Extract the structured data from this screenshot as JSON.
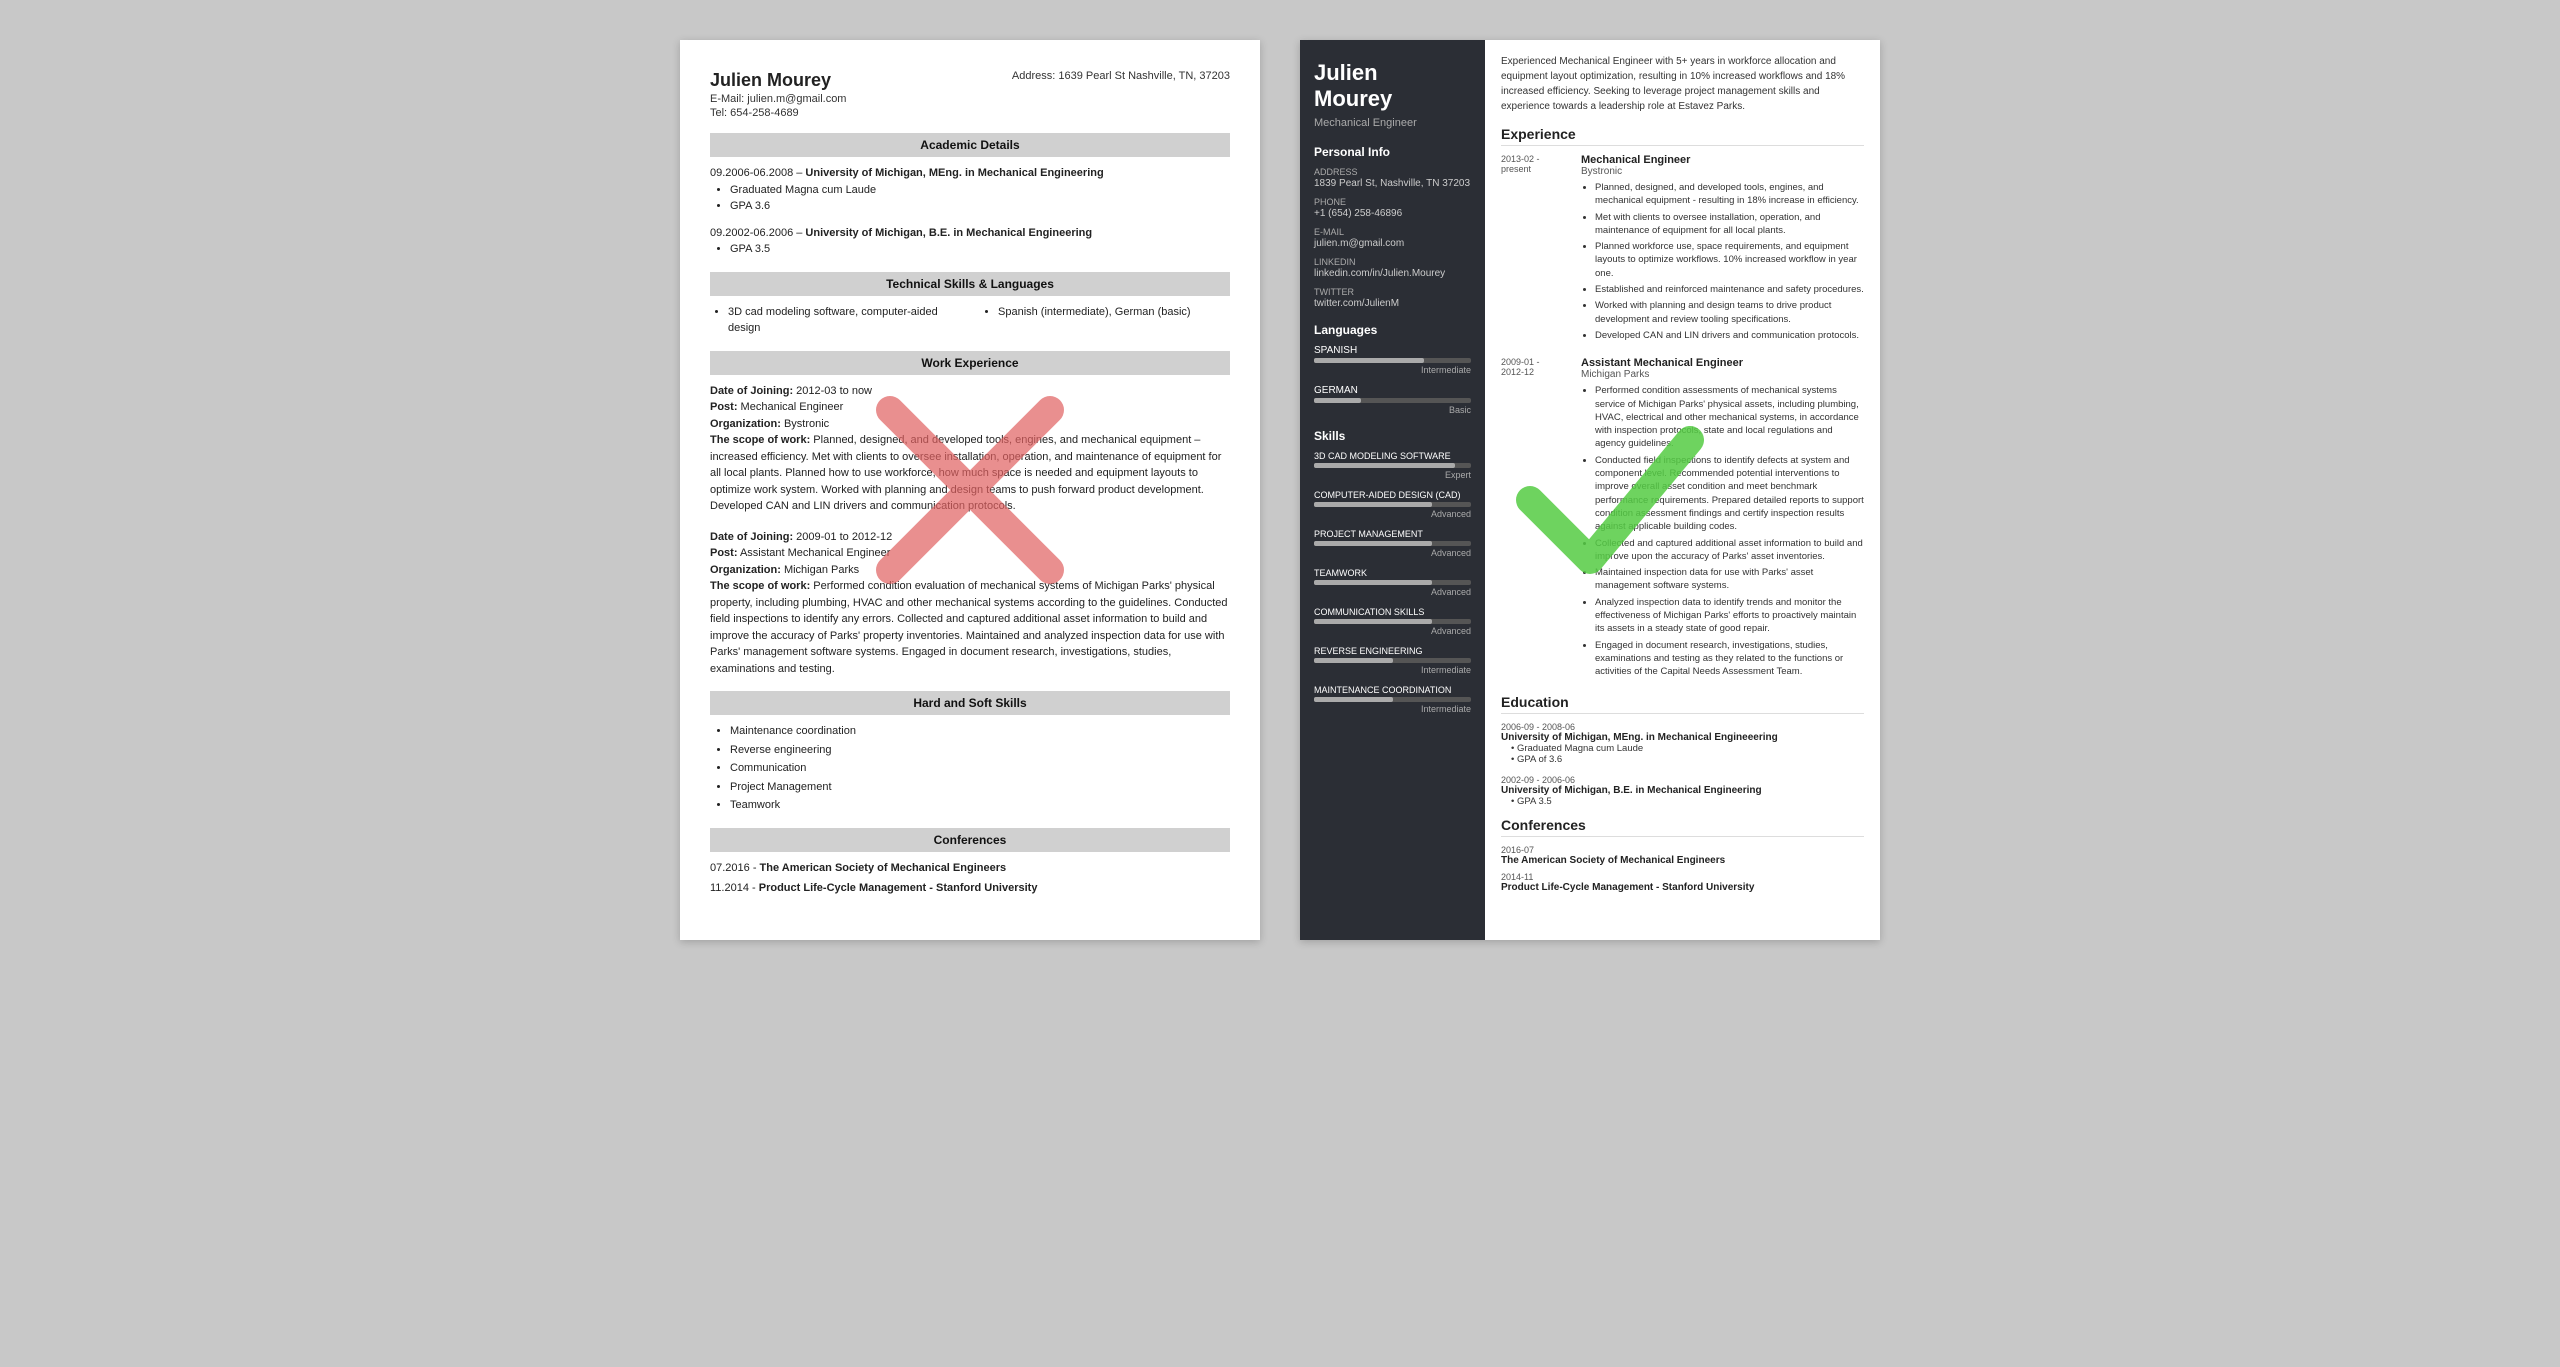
{
  "left": {
    "name": "Julien Mourey",
    "email": "E-Mail: julien.m@gmail.com",
    "tel": "Tel: 654-258-4689",
    "address": "Address: 1639 Pearl St Nashville, TN, 37203",
    "sections": {
      "academic": "Academic Details",
      "technical": "Technical Skills & Languages",
      "work": "Work Experience",
      "hard_soft": "Hard and Soft Skills",
      "conferences": "Conferences"
    },
    "education": [
      {
        "period": "09.2006-06.2008",
        "degree": "University of Michigan, MEng. in Mechanical Engineering",
        "bullets": [
          "Graduated Magna cum Laude",
          "GPA 3.6"
        ]
      },
      {
        "period": "09.2002-06.2006",
        "degree": "University of Michigan, B.E. in Mechanical Engineering",
        "bullets": [
          "GPA 3.5"
        ]
      }
    ],
    "tech_skills": [
      "3D cad modeling software, computer-aided design",
      "Spanish (intermediate), German (basic)"
    ],
    "work": [
      {
        "joining": "Date of Joining: 2012-03 to now",
        "post": "Post: Mechanical Engineer",
        "org": "Organization: Bystronic",
        "scope": "The scope of work: Planned, designed, and developed tools, engines, and mechanical equipment – increased efficiency. Met with clients to oversee installation, operation, and maintenance of equipment for all local plants. Planned how to use workforce, how much space is needed and equipment layouts to optimize work system. Worked with planning and design teams to push forward product development. Developed CAN and LIN drivers and communication protocols."
      },
      {
        "joining": "Date of Joining: 2009-01 to 2012-12",
        "post": "Post: Assistant Mechanical Engineer",
        "org": "Organization: Michigan Parks",
        "scope": "The scope of work: Performed condition evaluation of mechanical systems of Michigan Parks' physical property, including plumbing, HVAC and other mechanical systems according to the guidelines. Conducted field inspections to identify any errors. Collected and captured additional asset information to build and improve the accuracy of Parks' property inventories. Maintained and analyzed inspection data for use with Parks' management software systems. Engaged in document research, investigations, studies, examinations and testing."
      }
    ],
    "soft_skills": [
      "Maintenance coordination",
      "Reverse engineering",
      "Communication",
      "Project Management",
      "Teamwork"
    ],
    "conferences": [
      {
        "date": "07.2016",
        "name": "The American Society of Mechanical Engineers"
      },
      {
        "date": "11.2014",
        "name": "Product Life-Cycle Management - Stanford University"
      }
    ]
  },
  "right": {
    "name_line1": "Julien",
    "name_line2": "Mourey",
    "title": "Mechanical Engineer",
    "summary": "Experienced Mechanical Engineer with 5+ years in workforce allocation and equipment layout optimization, resulting in 10% increased workflows and 18% increased efficiency. Seeking to leverage project management skills and experience towards a leadership role at Estavez Parks.",
    "personal_info_title": "Personal Info",
    "personal": {
      "address_label": "Address",
      "address_value": "1839 Pearl St, Nashville, TN 37203",
      "phone_label": "Phone",
      "phone_value": "+1 (654) 258-46896",
      "email_label": "E-mail",
      "email_value": "julien.m@gmail.com",
      "linkedin_label": "LinkedIn",
      "linkedin_value": "linkedin.com/in/Julien.Mourey",
      "twitter_label": "Twitter",
      "twitter_value": "twitter.com/JulienM"
    },
    "languages_title": "Languages",
    "languages": [
      {
        "name": "SPANISH",
        "fill": 70,
        "level": "Intermediate"
      },
      {
        "name": "GERMAN",
        "fill": 30,
        "level": "Basic"
      }
    ],
    "skills_title": "Skills",
    "skills": [
      {
        "name": "3D CAD MODELING SOFTWARE",
        "fill": 90,
        "level": "Expert"
      },
      {
        "name": "COMPUTER-AIDED DESIGN (CAD)",
        "fill": 75,
        "level": "Advanced"
      },
      {
        "name": "PROJECT MANAGEMENT",
        "fill": 75,
        "level": "Advanced"
      },
      {
        "name": "TEAMWORK",
        "fill": 75,
        "level": "Advanced"
      },
      {
        "name": "COMMUNICATION SKILLS",
        "fill": 75,
        "level": "Advanced"
      },
      {
        "name": "REVERSE ENGINEERING",
        "fill": 50,
        "level": "Intermediate"
      },
      {
        "name": "MAINTENANCE COORDINATION",
        "fill": 50,
        "level": "Intermediate"
      }
    ],
    "experience_title": "Experience",
    "experience": [
      {
        "date": "2013-02 -\npresent",
        "job_title": "Mechanical Engineer",
        "company": "Bystronic",
        "bullets": [
          "Planned, designed, and developed tools, engines, and mechanical equipment - resulting in 18% increase in efficiency.",
          "Met with clients to oversee installation, operation, and maintenance of equipment for all local plants.",
          "Planned workforce use, space requirements, and equipment layouts to optimize workflows. 10% increased workflow in year one.",
          "Established and reinforced maintenance and safety procedures.",
          "Worked with planning and design teams to drive product development and review tooling specifications.",
          "Developed CAN and LIN drivers and communication protocols."
        ]
      },
      {
        "date": "2009-01 -\n2012-12",
        "job_title": "Assistant Mechanical Engineer",
        "company": "Michigan Parks",
        "bullets": [
          "Performed condition assessments of mechanical systems service of Michigan Parks' physical assets, including plumbing, HVAC, electrical and other mechanical systems, in accordance with inspection protocols, state and local regulations and agency guidelines.",
          "Conducted field inspections to identify defects at system and component level. Recommended potential interventions to improve overall asset condition and meet benchmark performance requirements. Prepared detailed reports to support condition assessment findings and certify inspection results against applicable building codes.",
          "Collected and captured additional asset information to build and improve upon the accuracy of Parks' asset inventories.",
          "Maintained inspection data for use with Parks' asset management software systems.",
          "Analyzed inspection data to identify trends and monitor the effectiveness of Michigan Parks' efforts to proactively maintain its assets in a steady state of good repair.",
          "Engaged in document research, investigations, studies, examinations and testing as they related to the functions or activities of the Capital Needs Assessment Team."
        ]
      }
    ],
    "education_title": "Education",
    "education": [
      {
        "date": "2006-09 -\n2008-06",
        "title": "University of Michigan, MEng. in Mechanical Engineeering",
        "bullets": [
          "Graduated Magna cum Laude",
          "GPA of 3.6"
        ]
      },
      {
        "date": "2002-09 -\n2006-06",
        "title": "University of Michigan, B.E. in Mechanical Engineering",
        "bullets": [
          "GPA 3.5"
        ]
      }
    ],
    "conferences_title": "Conferences",
    "conferences": [
      {
        "date": "2016-07",
        "name": "The American Society of Mechanical Engineers"
      },
      {
        "date": "2014-11",
        "name": "Product Life-Cycle Management - Stanford University"
      }
    ]
  }
}
